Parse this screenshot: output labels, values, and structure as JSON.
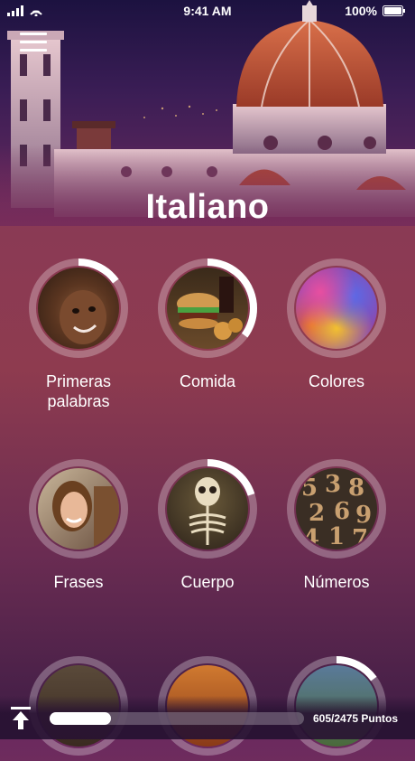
{
  "status": {
    "time": "9:41 AM",
    "battery": "100%"
  },
  "header": {
    "title": "Italiano"
  },
  "categories": [
    {
      "label": "Primeras\npalabras",
      "progress": 0.15,
      "photo": "baby"
    },
    {
      "label": "Comida",
      "progress": 0.35,
      "photo": "food"
    },
    {
      "label": "Colores",
      "progress": 0,
      "photo": "colors"
    },
    {
      "label": "Frases",
      "progress": 0,
      "photo": "woman"
    },
    {
      "label": "Cuerpo",
      "progress": 0.2,
      "photo": "skeleton"
    },
    {
      "label": "Números",
      "progress": 0,
      "photo": "numbers"
    },
    {
      "label": "",
      "progress": 0,
      "photo": "landscape"
    },
    {
      "label": "",
      "progress": 0,
      "photo": "orange"
    },
    {
      "label": "",
      "progress": 0.15,
      "photo": "field"
    }
  ],
  "footer": {
    "points": "605/2475 Puntos",
    "progress": 0.24
  }
}
